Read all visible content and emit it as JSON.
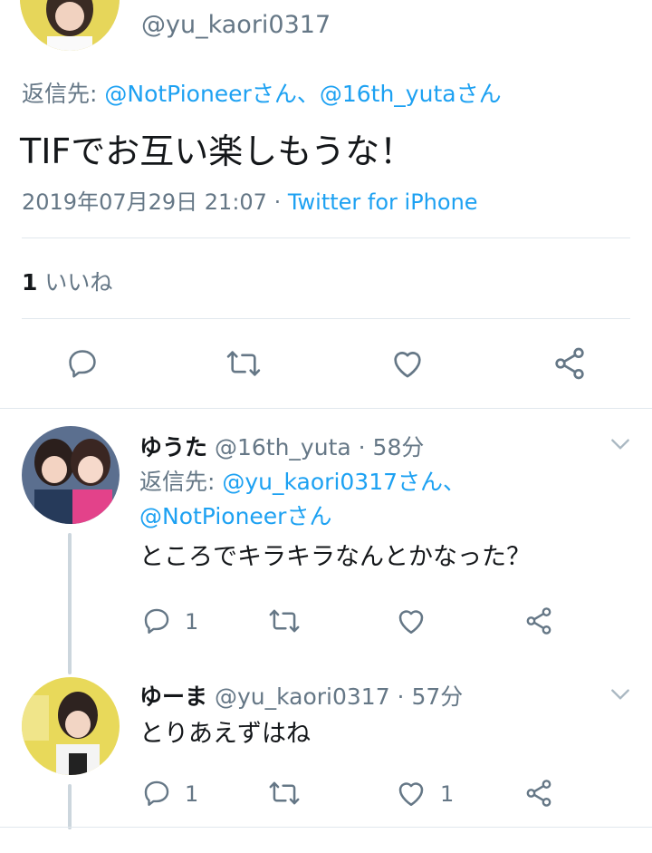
{
  "main_tweet": {
    "handle": "@yu_kaori0317",
    "reply_prefix": "返信先: ",
    "reply_to_1": "@NotPioneerさん",
    "reply_sep": "、",
    "reply_to_2": "@16th_yutaさん",
    "text": "TIFでお互い楽しもうな！",
    "datetime": "2019年07月29日 21:07",
    "dot": " · ",
    "source": "Twitter for iPhone",
    "likes_count": "1",
    "likes_label": "いいね"
  },
  "replies": [
    {
      "name": "ゆうた",
      "handle": "@16th_yuta",
      "time": "58分",
      "reply_prefix": "返信先: ",
      "reply_to_1": "@yu_kaori0317さん、",
      "reply_to_2": "@NotPioneerさん",
      "text": "ところでキラキラなんとかなった？",
      "reply_count": "1",
      "retweet_count": "",
      "like_count": ""
    },
    {
      "name": "ゆーま",
      "handle": "@yu_kaori0317",
      "time": "57分",
      "text": "とりあえずはね",
      "reply_count": "1",
      "retweet_count": "",
      "like_count": "1"
    }
  ],
  "colors": {
    "link": "#1da1f2",
    "muted": "#657786",
    "divider": "#e1e8ed"
  }
}
